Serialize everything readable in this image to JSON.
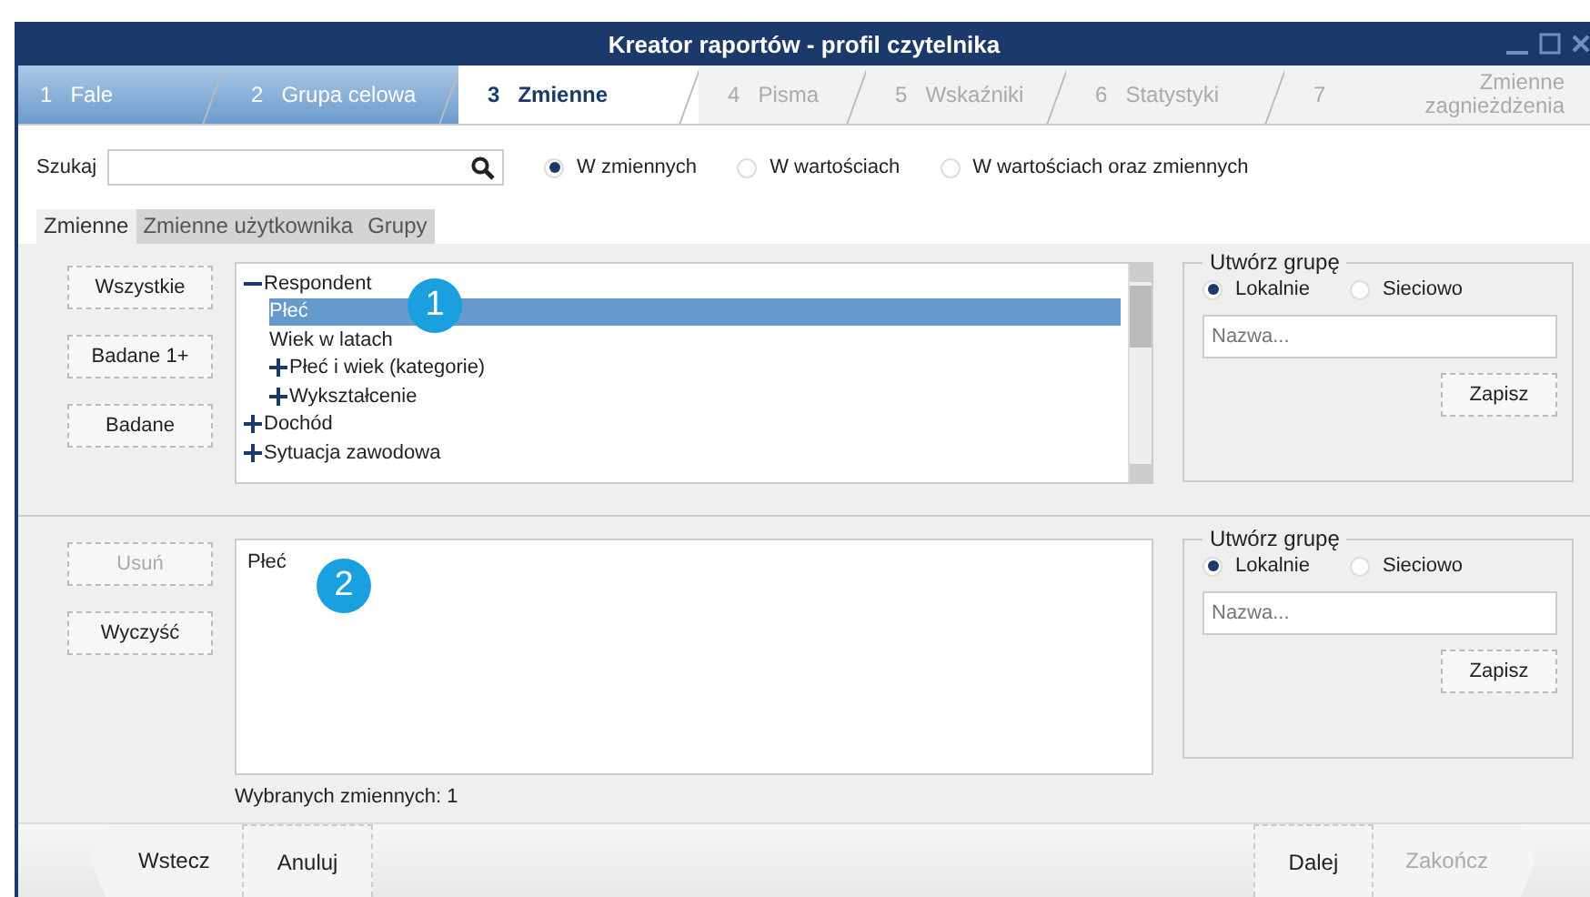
{
  "window": {
    "title": "Kreator raportów - profil czytelnika"
  },
  "steps": [
    {
      "number": "1",
      "label": "Fale",
      "completed": true,
      "selected": false
    },
    {
      "number": "2",
      "label": "Grupa celowa",
      "completed": true,
      "selected": false
    },
    {
      "number": "3",
      "label": "Zmienne",
      "completed": false,
      "selected": true
    },
    {
      "number": "4",
      "label": "Pisma",
      "completed": false,
      "selected": false
    },
    {
      "number": "5",
      "label": "Wskaźniki",
      "completed": false,
      "selected": false
    },
    {
      "number": "6",
      "label": "Statystyki",
      "completed": false,
      "selected": false
    },
    {
      "number": "7",
      "label": "Zmienne zagnieżdżenia",
      "completed": false,
      "selected": false
    }
  ],
  "search": {
    "label": "Szukaj"
  },
  "search_scope": [
    {
      "label": "W zmiennych",
      "selected": true
    },
    {
      "label": "W wartościach",
      "selected": false
    },
    {
      "label": "W wartościach oraz zmiennych",
      "selected": false
    }
  ],
  "tabs": [
    {
      "label": "Zmienne",
      "selected": true
    },
    {
      "label": "Zmienne użytkownika",
      "selected": false
    },
    {
      "label": "Grupy",
      "selected": false
    }
  ],
  "available": {
    "buttons": [
      {
        "label": "Wszystkie",
        "disabled": false
      },
      {
        "label": "Badane 1+",
        "disabled": false
      },
      {
        "label": "Badane",
        "disabled": false
      }
    ],
    "tree": [
      {
        "label": "Respondent",
        "expanded": true,
        "selected": false,
        "children": [
          {
            "label": "Płeć",
            "selected": true
          },
          {
            "label": "Wiek w latach",
            "selected": false
          },
          {
            "label": "Płeć i wiek (kategorie)",
            "expanded": false,
            "selected": false
          },
          {
            "label": "Wykształcenie",
            "expanded": false,
            "selected": false
          }
        ]
      },
      {
        "label": "Dochód",
        "expanded": false,
        "selected": false
      },
      {
        "label": "Sytuacja zawodowa",
        "expanded": false,
        "selected": false
      }
    ],
    "marker": "1",
    "group": {
      "title": "Utwórz grupę",
      "scope": [
        {
          "label": "Lokalnie",
          "selected": true
        },
        {
          "label": "Sieciowo",
          "selected": false
        }
      ],
      "placeholder": "Nazwa...",
      "save": "Zapisz"
    }
  },
  "chosen": {
    "buttons": [
      {
        "label": "Usuń",
        "disabled": true
      },
      {
        "label": "Wyczyść",
        "disabled": false
      }
    ],
    "items": [
      "Płeć"
    ],
    "marker": "2",
    "status": "Wybranych zmiennych: 1",
    "group": {
      "title": "Utwórz grupę",
      "scope": [
        {
          "label": "Lokalnie",
          "selected": true
        },
        {
          "label": "Sieciowo",
          "selected": false
        }
      ],
      "placeholder": "Nazwa...",
      "save": "Zapisz"
    }
  },
  "footer": {
    "left": [
      {
        "label": "Wstecz",
        "kind": "back",
        "disabled": false
      },
      {
        "label": "Anuluj",
        "kind": "plain",
        "disabled": false
      }
    ],
    "right": [
      {
        "label": "Dalej",
        "kind": "plain",
        "disabled": false
      },
      {
        "label": "Zakończ",
        "kind": "next",
        "disabled": true
      }
    ]
  }
}
